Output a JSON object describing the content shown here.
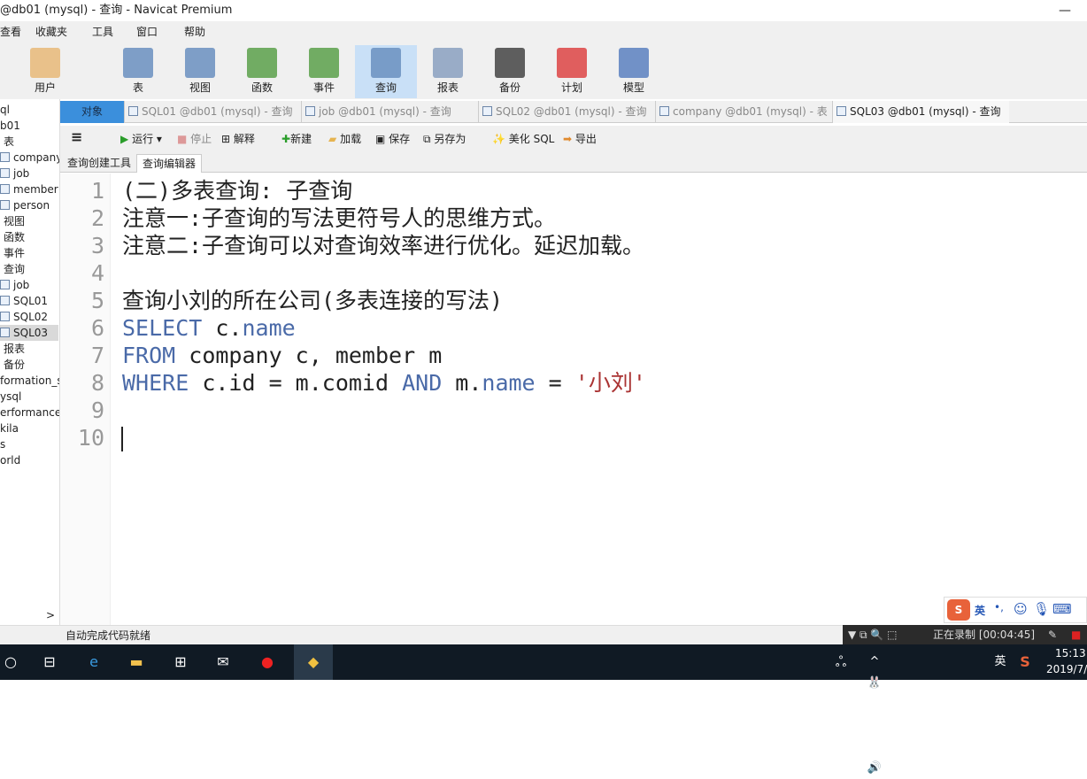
{
  "window": {
    "title": "@db01 (mysql) - 查询 - Navicat Premium",
    "minimize": "—"
  },
  "menu": [
    "查看",
    "收藏夹",
    "工具",
    "窗口",
    "帮助"
  ],
  "toolbar": [
    {
      "label": "用户",
      "icon": "user-icon"
    },
    {
      "label": "表",
      "icon": "table-icon"
    },
    {
      "label": "视图",
      "icon": "view-icon"
    },
    {
      "label": "函数",
      "icon": "function-icon"
    },
    {
      "label": "事件",
      "icon": "event-icon"
    },
    {
      "label": "查询",
      "icon": "query-icon",
      "active": true
    },
    {
      "label": "报表",
      "icon": "report-icon"
    },
    {
      "label": "备份",
      "icon": "backup-icon"
    },
    {
      "label": "计划",
      "icon": "schedule-icon"
    },
    {
      "label": "模型",
      "icon": "model-icon"
    }
  ],
  "sidebar": {
    "items": [
      "ql",
      "b01",
      "表",
      "company",
      "job",
      "member",
      "person",
      "视图",
      "函数",
      "事件",
      "查询",
      "job",
      "SQL01",
      "SQL02",
      "SQL03",
      "报表",
      "备份",
      "formation_s",
      "ysql",
      "erformance_",
      "kila",
      "s",
      "orld"
    ],
    "selected": "SQL03",
    "scroll_right": ">"
  },
  "tabs": [
    {
      "label": "对象"
    },
    {
      "label": "SQL01 @db01 (mysql) - 查询"
    },
    {
      "label": "job @db01 (mysql) - 查询"
    },
    {
      "label": "SQL02 @db01 (mysql) - 查询"
    },
    {
      "label": "company @db01 (mysql) - 表"
    },
    {
      "label": "SQL03 @db01 (mysql) - 查询",
      "active": true
    }
  ],
  "editor_toolbar": {
    "menu": "≡",
    "run": "运行",
    "stop": "停止",
    "explain": "解释",
    "new": "新建",
    "load": "加载",
    "save": "保存",
    "save_as": "另存为",
    "beautify": "美化 SQL",
    "export": "导出"
  },
  "subtabs": [
    "查询创建工具",
    "查询编辑器"
  ],
  "editor": {
    "line_numbers": [
      "1",
      "2",
      "3",
      "4",
      "5",
      "6",
      "7",
      "8",
      "9",
      "10"
    ],
    "lines": [
      [
        {
          "t": "(二)多表查询: 子查询"
        }
      ],
      [
        {
          "t": "注意一:子查询的写法更符号人的思维方式。"
        }
      ],
      [
        {
          "t": "注意二:子查询可以对查询效率进行优化。延迟加载。"
        }
      ],
      [],
      [
        {
          "t": "查询小刘的所在公司(多表连接的写法)"
        }
      ],
      [
        {
          "t": "SELECT",
          "k": 1
        },
        {
          "t": " c."
        },
        {
          "t": "name",
          "k": 1
        }
      ],
      [
        {
          "t": "FROM",
          "k": 1
        },
        {
          "t": " company c, member m"
        }
      ],
      [
        {
          "t": "WHERE",
          "k": 1
        },
        {
          "t": " c.id = m.comid "
        },
        {
          "t": "AND",
          "k": 1
        },
        {
          "t": " m."
        },
        {
          "t": "name",
          "k": 1
        },
        {
          "t": " = "
        },
        {
          "t": "'小刘'",
          "s": 1
        }
      ],
      [],
      []
    ]
  },
  "status": {
    "text": "自动完成代码就绪",
    "recording": "正在录制 [00:04:45]"
  },
  "ime": {
    "lang": "英",
    "punct": "•,"
  },
  "taskbar": {
    "time": "15:13",
    "date": "2019/7/",
    "lang": "英"
  },
  "colors": {
    "keyword": "#4a6aa8",
    "string": "#aa3333",
    "accent": "#3b8fdc"
  }
}
